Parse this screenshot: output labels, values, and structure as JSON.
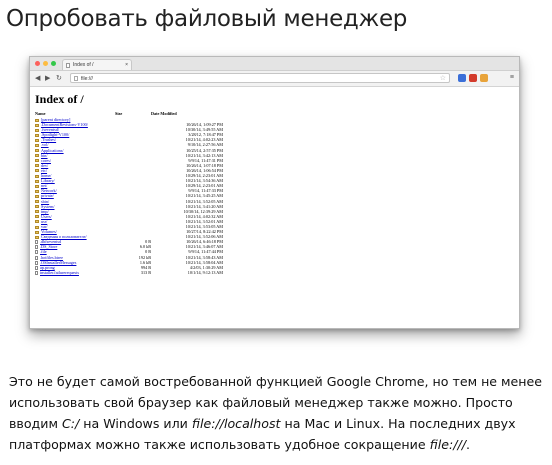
{
  "heading": "Опробовать файловый менеджер",
  "browser": {
    "tab_title": "Index of /",
    "tab_close": "×",
    "url": "file:///",
    "back": "◀",
    "forward": "▶",
    "reload": "↻",
    "star": "☆",
    "menu": "≡",
    "extension_colors": [
      "#3b6fd8",
      "#d33b2c",
      "#e8a33a"
    ]
  },
  "listing": {
    "title": "Index of /",
    "headers": {
      "name": "Name",
      "size": "Size",
      "date": "Date Modified"
    },
    "rows": [
      {
        "type": "up",
        "name": "[parent directory]",
        "size": "",
        "date": ""
      },
      {
        "type": "folder",
        "name": ".DocumentRevisions-V100/",
        "size": "",
        "date": "10/26/14, 1:09:27 PM"
      },
      {
        "type": "folder",
        "name": ".fseventsd/",
        "size": "",
        "date": "10/30/14, 3:49:55 AM"
      },
      {
        "type": "folder",
        "name": ".Spotlight-V100/",
        "size": "",
        "date": "3/28/12, 7:18:47 PM"
      },
      {
        "type": "folder",
        "name": ".Trashes/",
        "size": "",
        "date": "10/21/14, 4:02:23 AM"
      },
      {
        "type": "folder",
        "name": ".vol/",
        "size": "",
        "date": "9/10/14, 2:27:56 AM"
      },
      {
        "type": "folder",
        "name": "Applications/",
        "size": "",
        "date": "10/25/14, 2:57:35 PM"
      },
      {
        "type": "folder",
        "name": "bin/",
        "size": "",
        "date": "10/21/14, 3:42:13 AM"
      },
      {
        "type": "folder",
        "name": "cores/",
        "size": "",
        "date": "9/9/14, 11:47:31 PM"
      },
      {
        "type": "folder",
        "name": "dev/",
        "size": "",
        "date": "10/26/14, 1:07:18 PM"
      },
      {
        "type": "folder",
        "name": "etc/",
        "size": "",
        "date": "10/26/14, 1:06:54 PM"
      },
      {
        "type": "folder",
        "name": "home/",
        "size": "",
        "date": "10/29/14, 2:23:01 AM"
      },
      {
        "type": "folder",
        "name": "Library/",
        "size": "",
        "date": "10/21/14, 3:54:36 AM"
      },
      {
        "type": "folder",
        "name": "net/",
        "size": "",
        "date": "10/29/14, 2:23:01 AM"
      },
      {
        "type": "folder",
        "name": "Network/",
        "size": "",
        "date": "9/9/14, 11:47:33 PM"
      },
      {
        "type": "folder",
        "name": "private/",
        "size": "",
        "date": "10/21/14, 3:45:25 AM"
      },
      {
        "type": "folder",
        "name": "sbin/",
        "size": "",
        "date": "10/21/14, 3:52:05 AM"
      },
      {
        "type": "folder",
        "name": "System/",
        "size": "",
        "date": "10/21/14, 3:41:20 AM"
      },
      {
        "type": "folder",
        "name": "tmp/",
        "size": "",
        "date": "10/30/14, 12:39:29 AM"
      },
      {
        "type": "folder",
        "name": "Users/",
        "size": "",
        "date": "10/21/14, 4:02:32 AM"
      },
      {
        "type": "folder",
        "name": "usr/",
        "size": "",
        "date": "10/21/14, 3:52:01 AM"
      },
      {
        "type": "folder",
        "name": "var/",
        "size": "",
        "date": "10/21/14, 3:53:05 AM"
      },
      {
        "type": "folder",
        "name": "Volumes/",
        "size": "",
        "date": "10/27/14, 8:22:42 PM"
      },
      {
        "type": "folder",
        "name": "Сведения о пользователе/",
        "size": "",
        "date": "10/21/14, 3:52:06 AM"
      },
      {
        "type": "file",
        "name": ".dbfseventsd",
        "size": "0 B",
        "date": "10/26/14, 6:46:18 PM"
      },
      {
        "type": "file",
        "name": ".DS_Store",
        "size": "6.0 kB",
        "date": "10/21/14, 3:46:07 AM"
      },
      {
        "type": "file",
        "name": ".file",
        "size": "0 B",
        "date": "9/9/14, 11:47:44 PM"
      },
      {
        "type": "file",
        "name": ".hotfiles.btree",
        "size": "192 kB",
        "date": "10/21/14, 3:58:43 AM"
      },
      {
        "type": "file",
        "name": ".OSInstallerMessages",
        "size": "1.6 kB",
        "date": "10/21/14, 3:58:04 AM"
      },
      {
        "type": "file",
        "name": "ap.prong",
        "size": "994 B",
        "date": "4/2/03, 1:30:29 AM"
      },
      {
        "type": "file",
        "name": "installer.failurerequests",
        "size": "313 B",
        "date": "10/1/14, 9:12:13 AM"
      }
    ]
  },
  "paragraph": {
    "part1": "Это не будет самой востребованной функцией Google Chrome, но тем не менее использовать свой браузер как файловый менеджер также можно. Просто вводим ",
    "path_windows": "C:/",
    "part2": " на Windows или ",
    "path_unix": "file://localhost",
    "part3": " на Mac и Linux. На последних двух платформах можно также использовать удобное сокращение ",
    "shortcut": "file:///",
    "part4": "."
  }
}
